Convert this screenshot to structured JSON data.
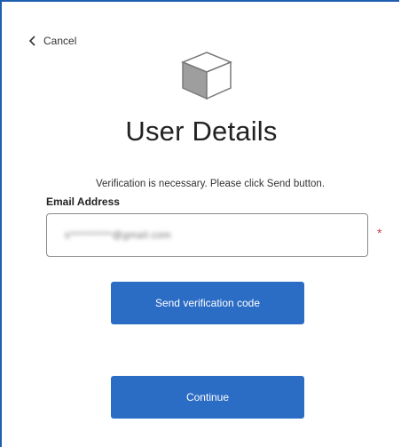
{
  "nav": {
    "cancel_label": "Cancel"
  },
  "logo": {
    "icon": "cube-icon"
  },
  "page": {
    "title": "User Details",
    "intro": "Verification is necessary. Please click Send button."
  },
  "form": {
    "email_label": "Email Address",
    "email_value": "s**********@gmail.com",
    "required_mark": "*"
  },
  "buttons": {
    "send_label": "Send verification code",
    "continue_label": "Continue"
  },
  "colors": {
    "accent": "#2b6cc4",
    "frame_border": "#1f5fb0",
    "required": "#d23b3b"
  }
}
